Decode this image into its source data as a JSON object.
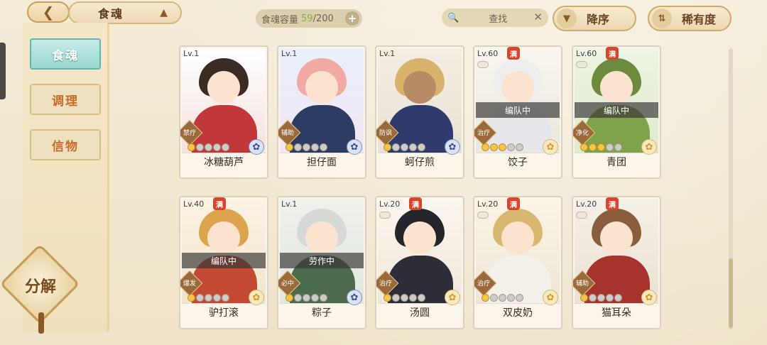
{
  "header": {
    "title": "食魂",
    "capacity": {
      "label": "食魂容量",
      "current": "59",
      "max": "/200"
    },
    "search": {
      "label": "查找"
    },
    "sort": {
      "label": "降序"
    },
    "rarity": {
      "label": "稀有度"
    }
  },
  "sidebar": {
    "tabs": [
      {
        "label": "食魂"
      },
      {
        "label": "调理"
      },
      {
        "label": "信物"
      }
    ],
    "decompose": {
      "label": "分解"
    }
  },
  "colors": {
    "accent_teal": "#9bd6d1",
    "max_badge": "#d6452d",
    "star_on": "#f1c64a"
  },
  "cards": [
    {
      "level": "Lv.1",
      "name": "冰糖葫芦",
      "role": "禁疗",
      "max": "",
      "status": "",
      "stars_on": 1,
      "emblem": "blue"
    },
    {
      "level": "Lv.1",
      "name": "担仔面",
      "role": "辅助",
      "max": "",
      "status": "",
      "stars_on": 1,
      "emblem": "blue"
    },
    {
      "level": "Lv.1",
      "name": "蚵仔煎",
      "role": "防讽",
      "max": "",
      "status": "",
      "stars_on": 1,
      "emblem": "blue"
    },
    {
      "level": "Lv.60",
      "name": "饺子",
      "role": "治疗",
      "max": "满",
      "status": "编队中",
      "stars_on": 3,
      "emblem": "gold"
    },
    {
      "level": "Lv.60",
      "name": "青团",
      "role": "净化",
      "max": "满",
      "status": "编队中",
      "stars_on": 3,
      "emblem": "gold"
    },
    {
      "level": "Lv.40",
      "name": "驴打滚",
      "role": "爆发",
      "max": "满",
      "status": "编队中",
      "stars_on": 1,
      "emblem": "gold"
    },
    {
      "level": "Lv.1",
      "name": "粽子",
      "role": "必中",
      "max": "",
      "status": "劳作中",
      "stars_on": 1,
      "emblem": "blue"
    },
    {
      "level": "Lv.20",
      "name": "汤圆",
      "role": "治疗",
      "max": "满",
      "status": "",
      "stars_on": 1,
      "emblem": "gold"
    },
    {
      "level": "Lv.20",
      "name": "双皮奶",
      "role": "治疗",
      "max": "满",
      "status": "",
      "stars_on": 1,
      "emblem": "gold"
    },
    {
      "level": "Lv.20",
      "name": "猫耳朵",
      "role": "辅助",
      "max": "满",
      "status": "",
      "stars_on": 1,
      "emblem": "gold"
    }
  ],
  "scroll": {
    "position": 0.75
  }
}
